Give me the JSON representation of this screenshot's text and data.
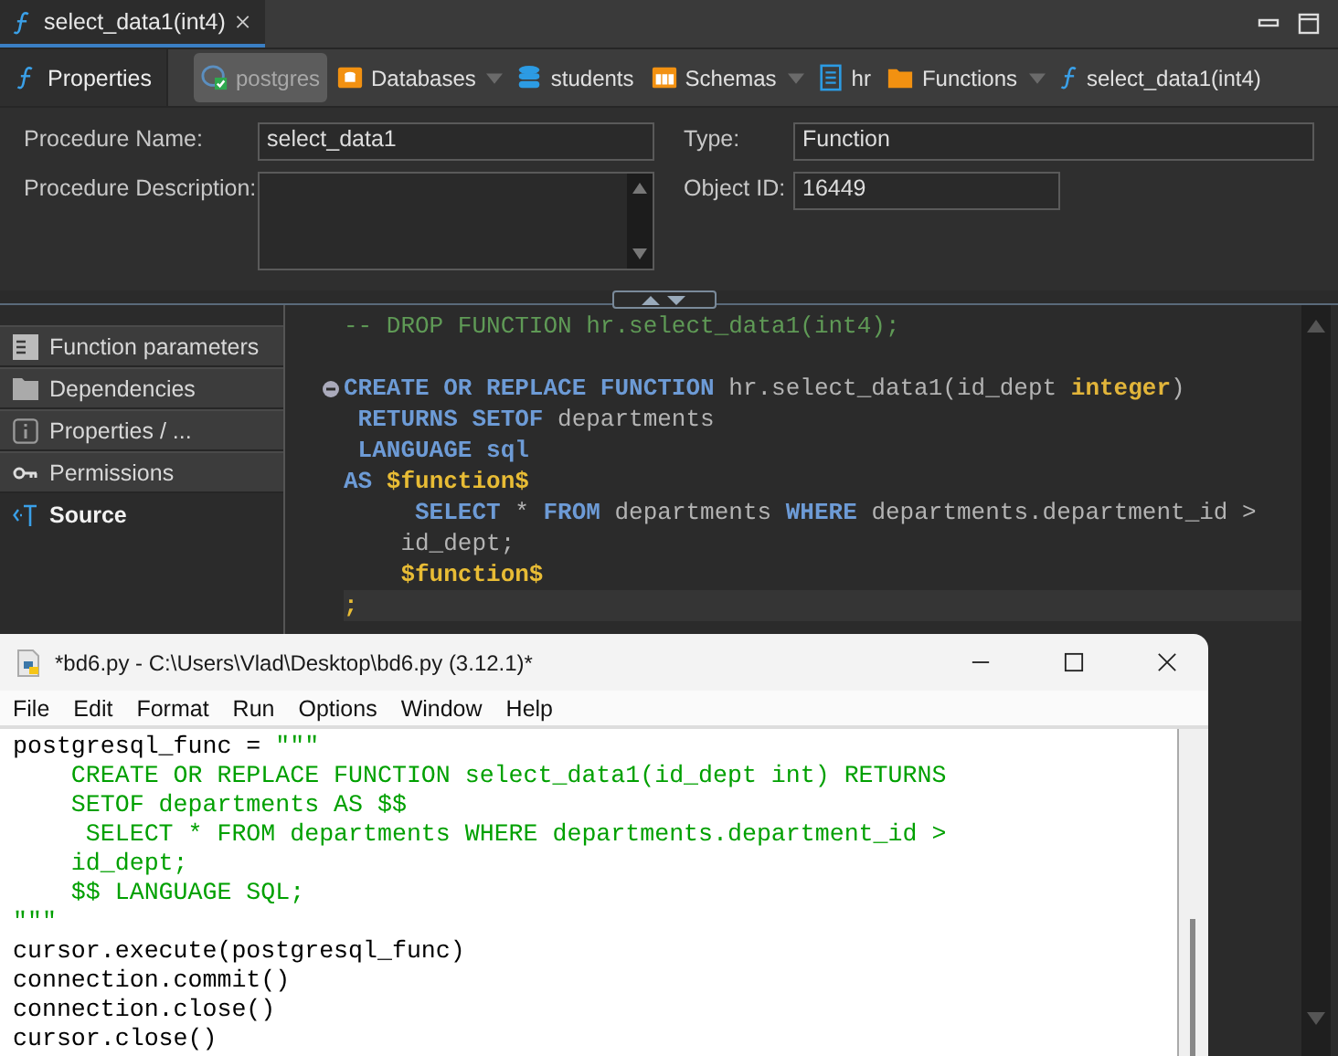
{
  "editor_tab": {
    "title": "select_data1(int4)",
    "selected": true
  },
  "breadcrumb": {
    "tabs": [
      {
        "label": "Properties",
        "selected": true
      }
    ],
    "items": [
      {
        "label": "postgres",
        "kind": "server",
        "selected": true,
        "dropdown": false
      },
      {
        "label": "Databases",
        "kind": "dbfolder",
        "selected": false,
        "dropdown": true
      },
      {
        "label": "students",
        "kind": "database",
        "selected": false,
        "dropdown": false
      },
      {
        "label": "Schemas",
        "kind": "schemas",
        "selected": false,
        "dropdown": true
      },
      {
        "label": "hr",
        "kind": "schema",
        "selected": false,
        "dropdown": false
      },
      {
        "label": "Functions",
        "kind": "folder",
        "selected": false,
        "dropdown": true
      },
      {
        "label": "select_data1(int4)",
        "kind": "function",
        "selected": false,
        "dropdown": false
      }
    ]
  },
  "form": {
    "left": [
      {
        "label": "Procedure Name:",
        "kind": "input",
        "value": "select_data1"
      },
      {
        "label": "Procedure Description:",
        "kind": "textarea"
      }
    ],
    "right": [
      {
        "label": "Type:",
        "kind": "input",
        "value": "Function"
      },
      {
        "label": "Object ID:",
        "kind": "short",
        "value": "16449"
      }
    ]
  },
  "nav": [
    {
      "label": "Function parameters",
      "kind": "parameters",
      "selected": false
    },
    {
      "label": "Dependencies",
      "kind": "dependencies",
      "selected": false
    },
    {
      "label": "Properties / ...",
      "kind": "properties",
      "selected": false
    },
    {
      "label": "Permissions",
      "kind": "permissions",
      "selected": false
    },
    {
      "label": "Source",
      "kind": "source",
      "selected": true
    }
  ],
  "sql": [
    {
      "kind": "code",
      "collapsible": false,
      "current": false,
      "tokens": [
        {
          "kind": "comment",
          "text": "-- DROP FUNCTION hr.select_data1(int4);"
        }
      ]
    },
    {
      "kind": "blank"
    },
    {
      "kind": "code",
      "collapsible": true,
      "current": false,
      "tokens": [
        {
          "kind": "keyword",
          "text": "CREATE OR REPLACE FUNCTION"
        },
        {
          "kind": "plain",
          "text": " hr.select_data1(id_dept "
        },
        {
          "kind": "type",
          "text": "integer"
        },
        {
          "kind": "plain",
          "text": ")"
        }
      ]
    },
    {
      "kind": "code",
      "collapsible": false,
      "current": false,
      "tokens": [
        {
          "kind": "keyword",
          "text": " RETURNS SETOF"
        },
        {
          "kind": "plain",
          "text": " departments"
        }
      ]
    },
    {
      "kind": "code",
      "collapsible": false,
      "current": false,
      "tokens": [
        {
          "kind": "keyword",
          "text": " LANGUAGE sql"
        }
      ]
    },
    {
      "kind": "code",
      "collapsible": false,
      "current": false,
      "tokens": [
        {
          "kind": "keyword",
          "text": "AS"
        },
        {
          "kind": "dollar",
          "text": " $function$"
        }
      ]
    },
    {
      "kind": "code",
      "collapsible": false,
      "current": false,
      "tokens": [
        {
          "kind": "keyword",
          "text": "     SELECT"
        },
        {
          "kind": "plain",
          "text": " * "
        },
        {
          "kind": "keyword",
          "text": "FROM"
        },
        {
          "kind": "plain",
          "text": " departments "
        },
        {
          "kind": "keyword",
          "text": "WHERE"
        },
        {
          "kind": "plain",
          "text": " departments.department_id >"
        }
      ]
    },
    {
      "kind": "code",
      "collapsible": false,
      "current": false,
      "tokens": [
        {
          "kind": "plain",
          "text": "    id_dept;"
        }
      ]
    },
    {
      "kind": "code",
      "collapsible": false,
      "current": false,
      "tokens": [
        {
          "kind": "dollar",
          "text": "    $function$"
        }
      ]
    },
    {
      "kind": "code",
      "collapsible": false,
      "current": true,
      "tokens": [
        {
          "kind": "dollar",
          "text": ";"
        }
      ]
    }
  ],
  "idle": {
    "title": "*bd6.py - C:\\Users\\Vlad\\Desktop\\bd6.py (3.12.1)*",
    "menu": [
      "File",
      "Edit",
      "Format",
      "Run",
      "Options",
      "Window",
      "Help"
    ],
    "lines": [
      [
        {
          "kind": "plain",
          "text": "postgresql_func = "
        },
        {
          "kind": "string",
          "text": "\"\"\""
        }
      ],
      [
        {
          "kind": "string",
          "text": "    CREATE OR REPLACE FUNCTION select_data1(id_dept int) RETURNS"
        }
      ],
      [
        {
          "kind": "string",
          "text": "    SETOF departments AS $$"
        }
      ],
      [
        {
          "kind": "string",
          "text": "     SELECT * FROM departments WHERE departments.department_id >"
        }
      ],
      [
        {
          "kind": "string",
          "text": "    id_dept;"
        }
      ],
      [
        {
          "kind": "string",
          "text": "    $$ LANGUAGE SQL;"
        }
      ],
      [
        {
          "kind": "string",
          "text": "\"\"\""
        }
      ],
      [
        {
          "kind": "plain",
          "text": "cursor.execute(postgresql_func)"
        }
      ],
      [
        {
          "kind": "plain",
          "text": "connection.commit()"
        }
      ],
      [
        {
          "kind": "plain",
          "text": "connection.close()"
        }
      ],
      [
        {
          "kind": "plain",
          "text": "cursor.close()"
        }
      ]
    ]
  }
}
